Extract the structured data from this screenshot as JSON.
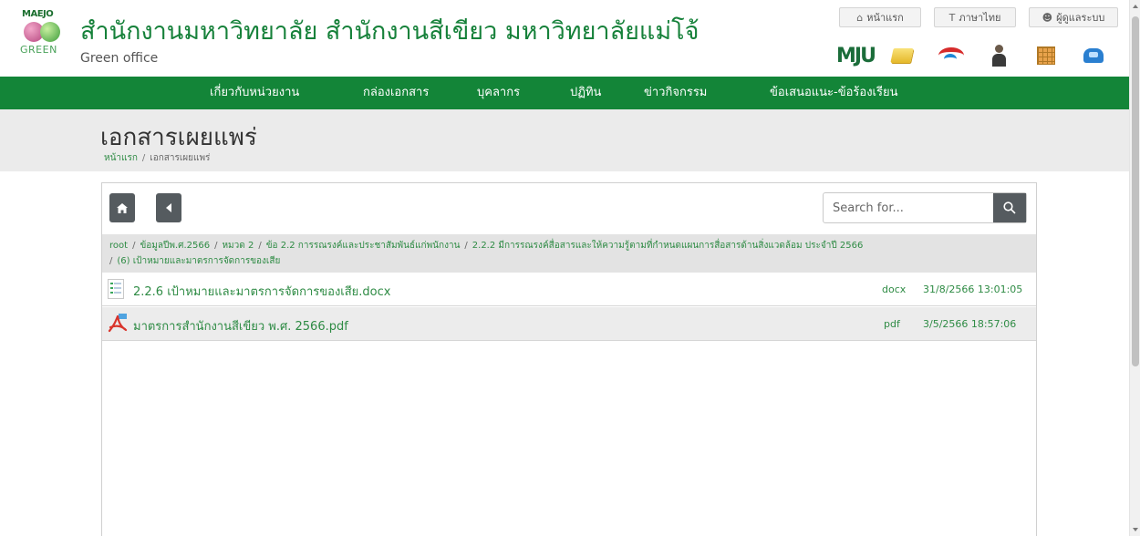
{
  "header": {
    "logo_top": "MAEJO",
    "logo_bottom": "GREEN",
    "title": "สำนักงานมหาวิทยาลัย สำนักงานสีเขียว มหาวิทยาลัยแม่โจ้",
    "subtitle": "Green office",
    "buttons": {
      "home": "หน้าแรก",
      "language": "ภาษาไทย",
      "admin": "ผู้ดูแลระบบ"
    },
    "quick_icons": [
      "mju-logo",
      "folder-icon",
      "swoosh-icon",
      "person-icon",
      "calendar-icon",
      "phone-icon"
    ],
    "mju_text": "MJU"
  },
  "nav": {
    "items": [
      "เกี่ยวกับหน่วยงาน",
      "กล่องเอกสาร",
      "บุคลากร",
      "ปฏิทิน",
      "ข่าวกิจกรรม",
      "ข้อเสนอแนะ-ข้อร้องเรียน"
    ]
  },
  "page": {
    "title": "เอกสารเผยแพร่",
    "breadcrumb": [
      "หน้าแรก",
      "เอกสารเผยแพร่"
    ]
  },
  "file_manager": {
    "search_placeholder": "Search for...",
    "path": [
      "root",
      "ข้อมูลปีพ.ศ.2566",
      "หมวด 2",
      "ข้อ 2.2 การรณรงค์และประชาสัมพันธ์แก่พนักงาน",
      "2.2.2 มีการรณรงค์สื่อสารและให้ความรู้ตามที่กำหนดแผนการสื่อสารด้านสิ่งแวดล้อม ประจำปี 2566",
      "(6) เป้าหมายและมาตรการจัดการของเสีย"
    ],
    "files": [
      {
        "name": "2.2.6 เป้าหมายและมาตรการจัดการของเสีย.docx",
        "type": "docx",
        "date": "31/8/2566 13:01:05",
        "icon": "docx-icon"
      },
      {
        "name": "มาตรการสำนักงานสีเขียว พ.ศ. 2566.pdf",
        "type": "pdf",
        "date": "3/5/2566 18:57:06",
        "icon": "pdf-icon"
      }
    ]
  },
  "colors": {
    "brand_green": "#138538",
    "link_green": "#2e8b44",
    "title_band": "#ebebeb",
    "button_dark": "#555b5f"
  }
}
